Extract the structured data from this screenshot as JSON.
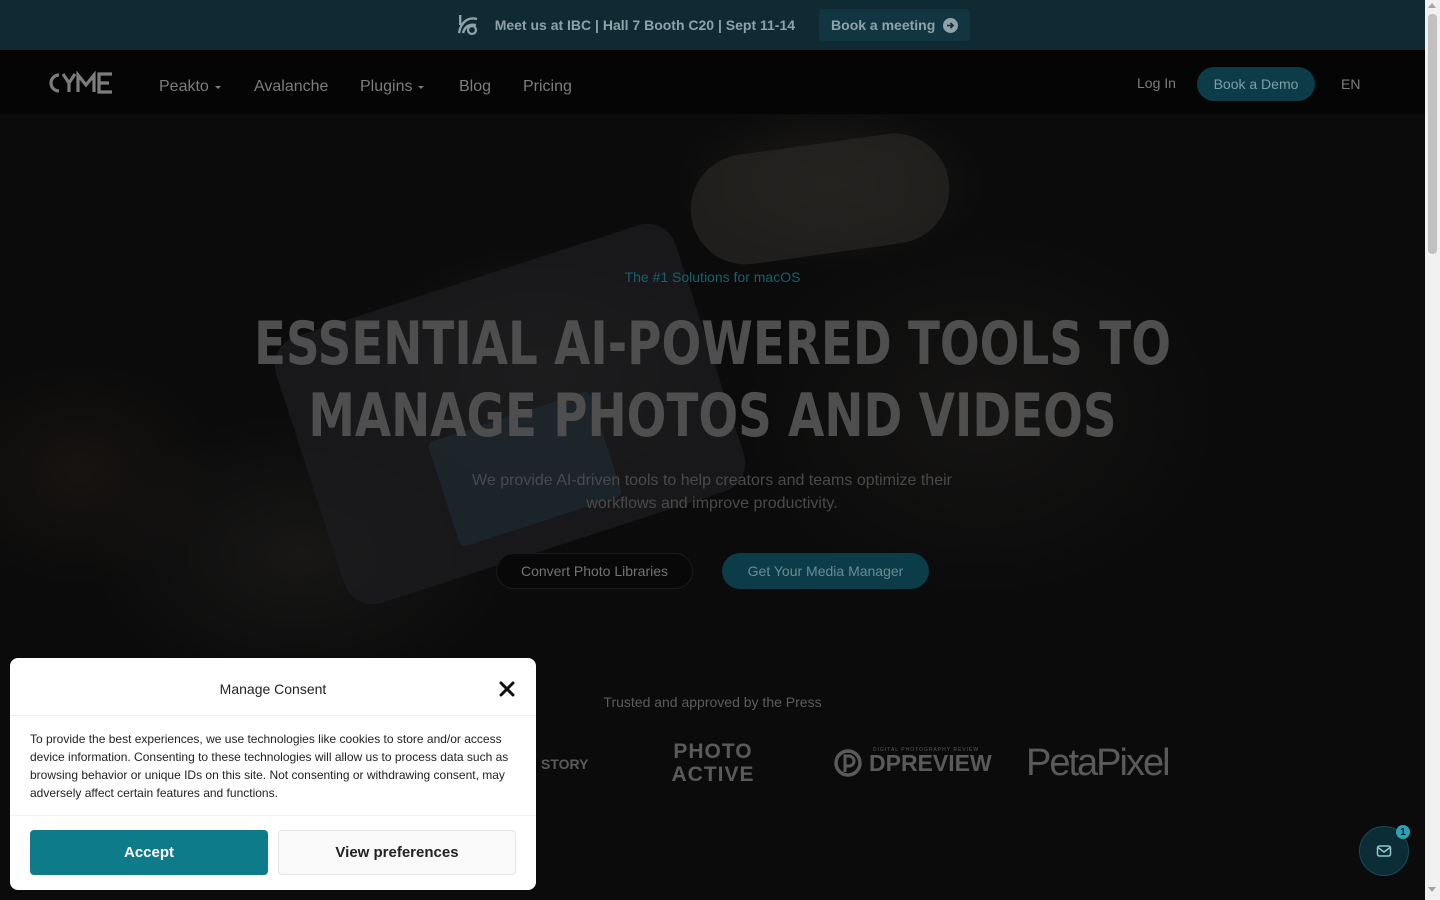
{
  "announcement": {
    "text": "Meet us at IBC | Hall 7 Booth C20 | Sept 11-14",
    "button_label": "Book a meeting"
  },
  "navbar": {
    "logo_text": "CYME",
    "items": [
      {
        "label": "Peakto",
        "has_dropdown": true
      },
      {
        "label": "Avalanche",
        "has_dropdown": false
      },
      {
        "label": "Plugins",
        "has_dropdown": true
      },
      {
        "label": "Blog",
        "has_dropdown": false
      },
      {
        "label": "Pricing",
        "has_dropdown": false
      }
    ],
    "login_label": "Log In",
    "cta_label": "Book a Demo",
    "language": "EN"
  },
  "hero": {
    "eyebrow": "The #1 Solutions for macOS",
    "headline_line1": "ESSENTIAL AI-POWERED TOOLS TO",
    "headline_line2": "MANAGE PHOTOS AND VIDEOS",
    "subtext": "We provide AI-driven tools to help creators and teams optimize their workflows and improve productivity.",
    "primary_button": "Convert Photo Libraries",
    "secondary_button": "Get Your Media Manager"
  },
  "press": {
    "heading": "Trusted and approved by the Press",
    "logos": [
      {
        "name": "story-logo",
        "text": "STORY"
      },
      {
        "name": "photoactive-logo",
        "text_line1": "PHOTO",
        "text_line2": "ACTIVE"
      },
      {
        "name": "dpreview-logo",
        "text": "DPREVIEW",
        "small_text": "DIGITAL PHOTOGRAPHY REVIEW"
      },
      {
        "name": "petapixel-logo",
        "text": "PetaPixel"
      }
    ]
  },
  "chat_widget": {
    "badge_count": "1",
    "icon": "mail-icon"
  },
  "consent": {
    "title": "Manage Consent",
    "body": "To provide the best experiences, we use technologies like cookies to store and/or access device information. Consenting to these technologies will allow us to process data such as browsing behavior or unique IDs on this site. Not consenting or withdrawing consent, may adversely affect certain features and functions.",
    "accept_label": "Accept",
    "preferences_label": "View preferences"
  },
  "colors": {
    "accent": "#0e7b8a",
    "announcement_bg": "#0f2a33",
    "nav_bg": "#050505"
  }
}
